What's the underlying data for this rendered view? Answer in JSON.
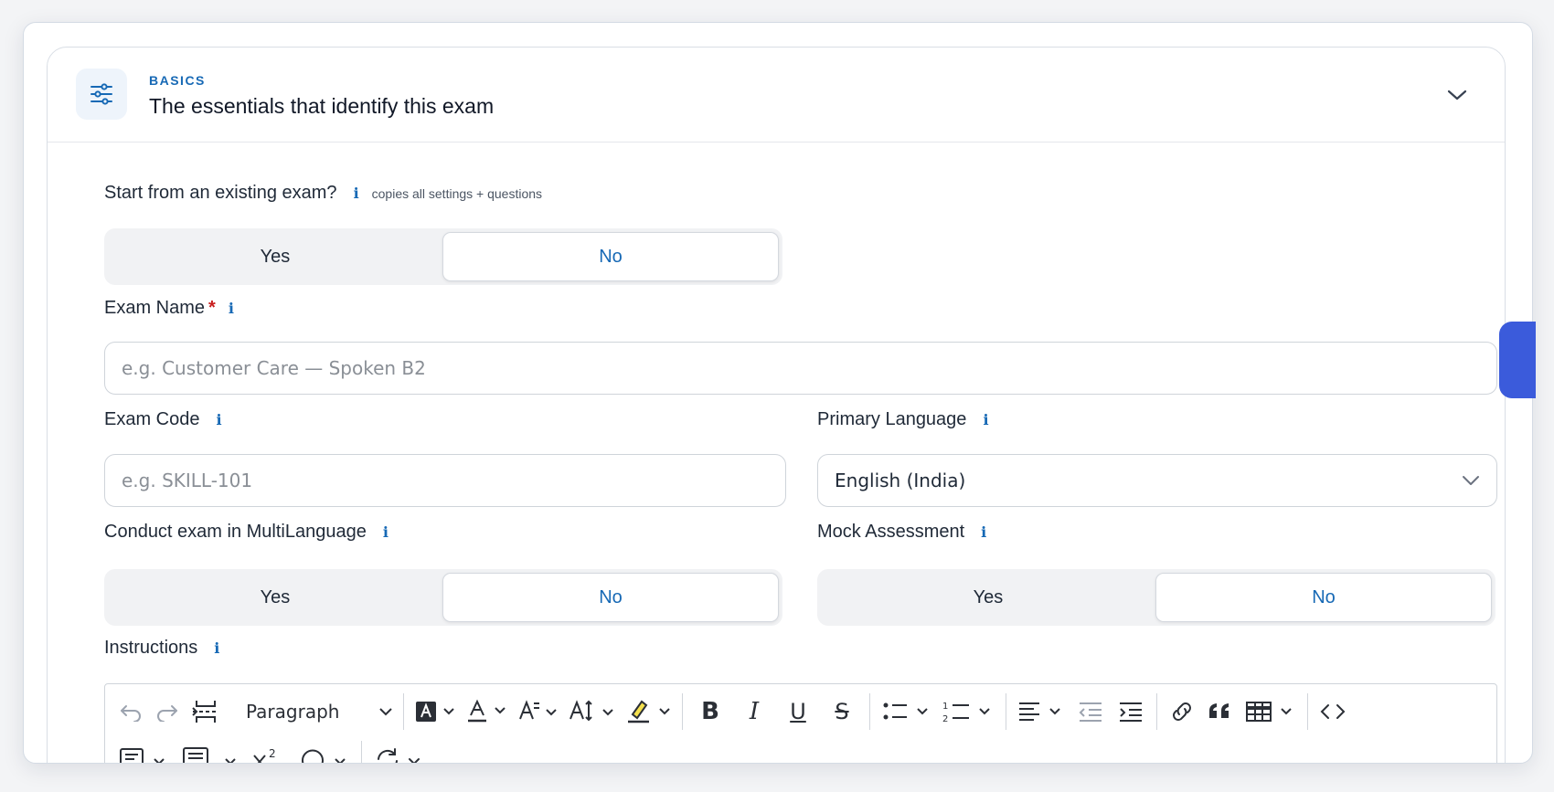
{
  "section": {
    "eyebrow": "BASICS",
    "title": "The essentials that identify this exam",
    "icon": "sliders-icon",
    "toggle_icon": "chevron-down-icon"
  },
  "start_existing": {
    "label": "Start from an existing exam?",
    "hint": "copies all settings + questions",
    "options": [
      "Yes",
      "No"
    ],
    "selected": "No"
  },
  "exam_name": {
    "label": "Exam Name",
    "required_mark": "*",
    "placeholder": "e.g. Customer Care — Spoken B2",
    "value": ""
  },
  "exam_code": {
    "label": "Exam Code",
    "placeholder": "e.g. SKILL-101",
    "value": ""
  },
  "primary_language": {
    "label": "Primary Language",
    "value": "English (India)"
  },
  "multilanguage": {
    "label": "Conduct exam in MultiLanguage",
    "options": [
      "Yes",
      "No"
    ],
    "selected": "No"
  },
  "mock": {
    "label": "Mock Assessment",
    "options": [
      "Yes",
      "No"
    ],
    "selected": "No"
  },
  "instructions": {
    "label": "Instructions",
    "toolbar": {
      "paragraph_value": "Paragraph"
    }
  },
  "info_glyph": "i",
  "colors": {
    "accent": "#1769b5",
    "required": "#c81e1e",
    "side_tab": "#3b5bdb"
  }
}
